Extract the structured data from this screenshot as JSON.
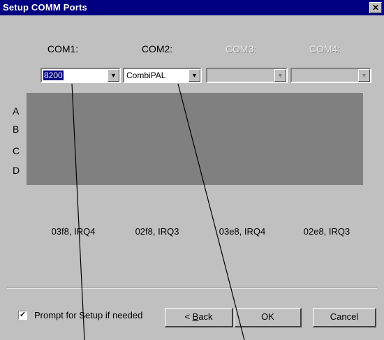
{
  "window": {
    "title": "Setup COMM Ports",
    "close_glyph": "✕"
  },
  "ports": [
    {
      "label": "COM1:",
      "selected": "8200",
      "enabled": true,
      "address": "03f8, IRQ4"
    },
    {
      "label": "COM2:",
      "selected": "CombiPAL",
      "enabled": true,
      "address": "02f8, IRQ3"
    },
    {
      "label": "COM3:",
      "selected": "",
      "enabled": false,
      "address": "03e8, IRQ4"
    },
    {
      "label": "COM4:",
      "selected": "",
      "enabled": false,
      "address": "02e8, IRQ3"
    }
  ],
  "rows": [
    "A",
    "B",
    "C",
    "D"
  ],
  "prompt_checkbox": {
    "label": "Prompt for Setup if needed",
    "checked": true
  },
  "buttons": {
    "back_prefix": "< ",
    "back_mnemonic": "B",
    "back_rest": "ack",
    "ok": "OK",
    "cancel": "Cancel"
  },
  "icons": {
    "dropdown": "down-triangle-icon",
    "check": "checkmark-icon"
  }
}
